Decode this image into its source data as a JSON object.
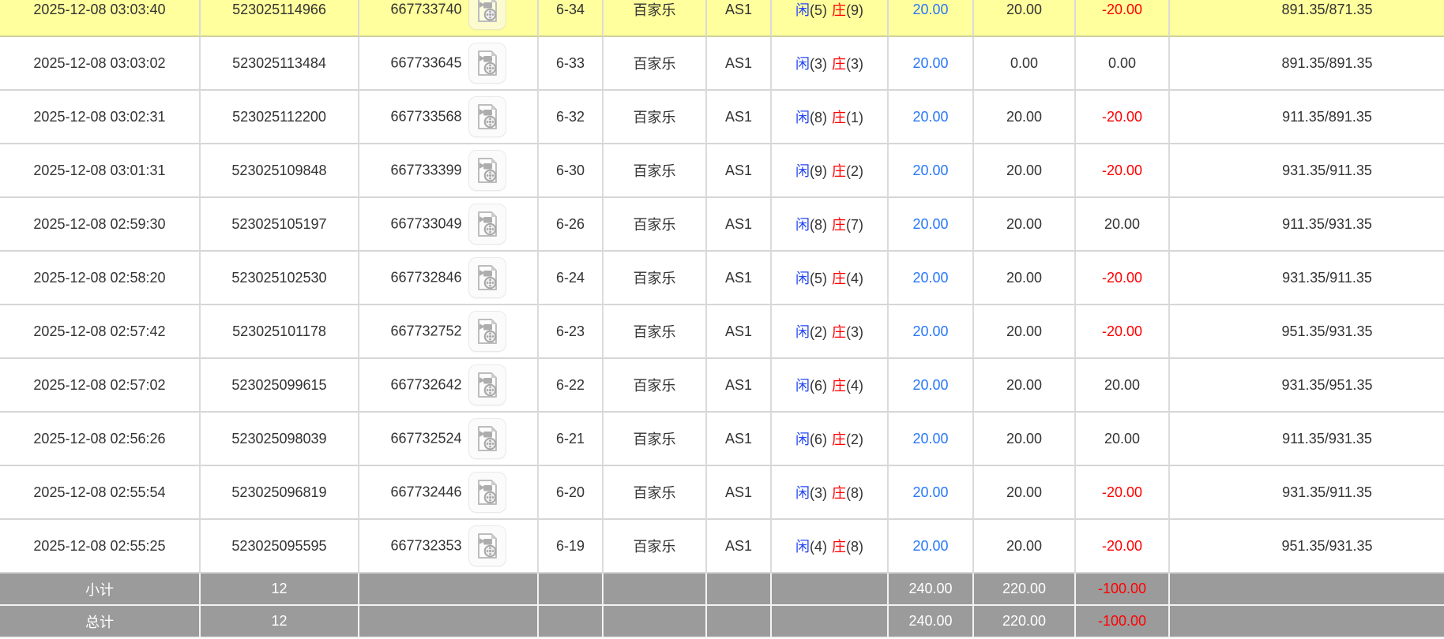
{
  "colors": {
    "highlight_row": "#ffff9d",
    "player_blue": "#2244f5",
    "banker_red": "#ff0000",
    "bet_amount_blue": "#2878f8",
    "loss_red": "#ff0000",
    "footer_gray": "#9b9b9b",
    "grid_line": "#dbdbdb"
  },
  "icons": {
    "video_replay": "video-file-icon"
  },
  "table": {
    "result_labels": {
      "player": "闲",
      "banker": "庄"
    },
    "rows": [
      {
        "time": "2025-12-08 03:03:40",
        "bet_id": "523025114966",
        "game_id": "667733740",
        "round": "6-34",
        "game": "百家乐",
        "table_name": "AS1",
        "result": {
          "player": "(5)",
          "banker": "(9)"
        },
        "bet_amount": "20.00",
        "valid_amount": "20.00",
        "win_loss": "-20.00",
        "balance": "891.35/871.35",
        "highlighted": true
      },
      {
        "time": "2025-12-08 03:03:02",
        "bet_id": "523025113484",
        "game_id": "667733645",
        "round": "6-33",
        "game": "百家乐",
        "table_name": "AS1",
        "result": {
          "player": "(3)",
          "banker": "(3)"
        },
        "bet_amount": "20.00",
        "valid_amount": "0.00",
        "win_loss": "0.00",
        "balance": "891.35/891.35",
        "highlighted": false
      },
      {
        "time": "2025-12-08 03:02:31",
        "bet_id": "523025112200",
        "game_id": "667733568",
        "round": "6-32",
        "game": "百家乐",
        "table_name": "AS1",
        "result": {
          "player": "(8)",
          "banker": "(1)"
        },
        "bet_amount": "20.00",
        "valid_amount": "20.00",
        "win_loss": "-20.00",
        "balance": "911.35/891.35",
        "highlighted": false
      },
      {
        "time": "2025-12-08 03:01:31",
        "bet_id": "523025109848",
        "game_id": "667733399",
        "round": "6-30",
        "game": "百家乐",
        "table_name": "AS1",
        "result": {
          "player": "(9)",
          "banker": "(2)"
        },
        "bet_amount": "20.00",
        "valid_amount": "20.00",
        "win_loss": "-20.00",
        "balance": "931.35/911.35",
        "highlighted": false
      },
      {
        "time": "2025-12-08 02:59:30",
        "bet_id": "523025105197",
        "game_id": "667733049",
        "round": "6-26",
        "game": "百家乐",
        "table_name": "AS1",
        "result": {
          "player": "(8)",
          "banker": "(7)"
        },
        "bet_amount": "20.00",
        "valid_amount": "20.00",
        "win_loss": "20.00",
        "balance": "911.35/931.35",
        "highlighted": false
      },
      {
        "time": "2025-12-08 02:58:20",
        "bet_id": "523025102530",
        "game_id": "667732846",
        "round": "6-24",
        "game": "百家乐",
        "table_name": "AS1",
        "result": {
          "player": "(5)",
          "banker": "(4)"
        },
        "bet_amount": "20.00",
        "valid_amount": "20.00",
        "win_loss": "-20.00",
        "balance": "931.35/911.35",
        "highlighted": false
      },
      {
        "time": "2025-12-08 02:57:42",
        "bet_id": "523025101178",
        "game_id": "667732752",
        "round": "6-23",
        "game": "百家乐",
        "table_name": "AS1",
        "result": {
          "player": "(2)",
          "banker": "(3)"
        },
        "bet_amount": "20.00",
        "valid_amount": "20.00",
        "win_loss": "-20.00",
        "balance": "951.35/931.35",
        "highlighted": false
      },
      {
        "time": "2025-12-08 02:57:02",
        "bet_id": "523025099615",
        "game_id": "667732642",
        "round": "6-22",
        "game": "百家乐",
        "table_name": "AS1",
        "result": {
          "player": "(6)",
          "banker": "(4)"
        },
        "bet_amount": "20.00",
        "valid_amount": "20.00",
        "win_loss": "20.00",
        "balance": "931.35/951.35",
        "highlighted": false
      },
      {
        "time": "2025-12-08 02:56:26",
        "bet_id": "523025098039",
        "game_id": "667732524",
        "round": "6-21",
        "game": "百家乐",
        "table_name": "AS1",
        "result": {
          "player": "(6)",
          "banker": "(2)"
        },
        "bet_amount": "20.00",
        "valid_amount": "20.00",
        "win_loss": "20.00",
        "balance": "911.35/931.35",
        "highlighted": false
      },
      {
        "time": "2025-12-08 02:55:54",
        "bet_id": "523025096819",
        "game_id": "667732446",
        "round": "6-20",
        "game": "百家乐",
        "table_name": "AS1",
        "result": {
          "player": "(3)",
          "banker": "(8)"
        },
        "bet_amount": "20.00",
        "valid_amount": "20.00",
        "win_loss": "-20.00",
        "balance": "931.35/911.35",
        "highlighted": false
      },
      {
        "time": "2025-12-08 02:55:25",
        "bet_id": "523025095595",
        "game_id": "667732353",
        "round": "6-19",
        "game": "百家乐",
        "table_name": "AS1",
        "result": {
          "player": "(4)",
          "banker": "(8)"
        },
        "bet_amount": "20.00",
        "valid_amount": "20.00",
        "win_loss": "-20.00",
        "balance": "951.35/931.35",
        "highlighted": false
      }
    ],
    "subtotal": {
      "label": "小计",
      "count": "12",
      "bet_amount": "240.00",
      "valid_amount": "220.00",
      "win_loss": "-100.00"
    },
    "total": {
      "label": "总计",
      "count": "12",
      "bet_amount": "240.00",
      "valid_amount": "220.00",
      "win_loss": "-100.00"
    }
  }
}
